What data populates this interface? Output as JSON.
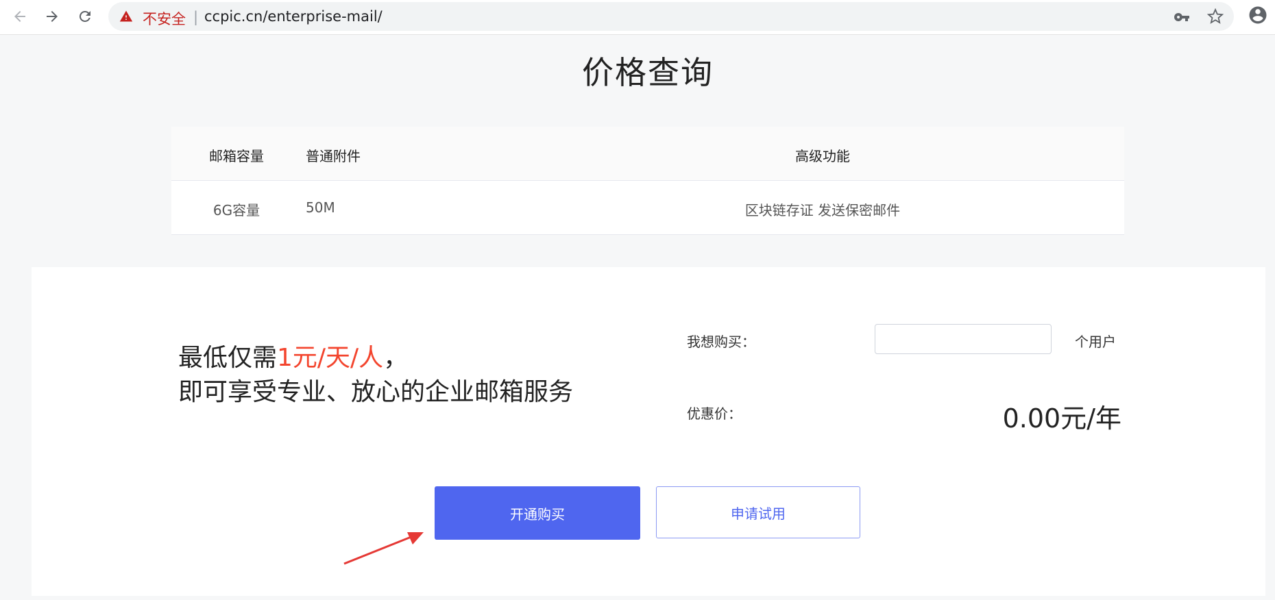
{
  "browser": {
    "security_label": "不安全",
    "separator": "|",
    "url": "ccpic.cn/enterprise-mail/",
    "icons": [
      "back-arrow-icon",
      "forward-arrow-icon",
      "reload-icon",
      "warning-icon",
      "key-icon",
      "star-icon",
      "account-icon"
    ]
  },
  "page": {
    "title": "价格查询"
  },
  "spec_table": {
    "headers": [
      "邮箱容量",
      "普通附件",
      "高级功能"
    ],
    "rows": [
      [
        "6G容量",
        "50M",
        "区块链存证 发送保密邮件"
      ]
    ]
  },
  "purchase": {
    "promo_prefix": "最低仅需",
    "promo_highlight": "1元/天/人",
    "promo_suffix": "，",
    "promo_line2": "即可享受专业、放心的企业邮箱服务",
    "buy_label": "我想购买：",
    "quantity_value": "",
    "unit_label": "个用户",
    "discount_label": "优惠价：",
    "price": "0.00元/年",
    "buy_button": "开通购买",
    "trial_button": "申请试用"
  },
  "colors": {
    "accent": "#4f66ef",
    "highlight": "#f3452e",
    "warning": "#c5221f",
    "annotation_arrow": "#e53935"
  }
}
